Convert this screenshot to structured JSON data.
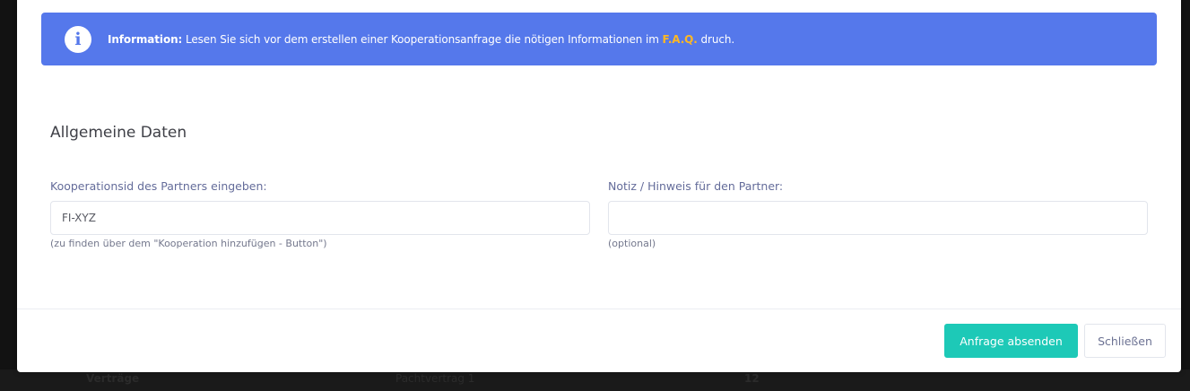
{
  "background": {
    "row": {
      "col1": "Verträge",
      "col2": "Pachtvertrag 1",
      "col3": "12"
    }
  },
  "alert": {
    "icon": "info-icon",
    "label": "Information:",
    "text_before": " Lesen Sie sich vor dem erstellen einer Kooperationsanfrage die nötigen Informationen im ",
    "link": "F.A.Q.",
    "text_after": " druch.",
    "color": "#5578eb",
    "link_color": "#ffb822"
  },
  "section": {
    "title": "Allgemeine Daten"
  },
  "fields": {
    "cooperation_id": {
      "label": "Kooperationsid des Partners eingeben:",
      "placeholder": "FI-XYZ",
      "value": "",
      "help": "(zu finden über dem \"Kooperation hinzufügen - Button\")"
    },
    "note": {
      "label": "Notiz / Hinweis für den Partner:",
      "placeholder": "",
      "value": "",
      "help": "(optional)"
    }
  },
  "footer": {
    "submit_label": "Anfrage absenden",
    "close_label": "Schließen",
    "submit_color": "#1dc9b7"
  }
}
